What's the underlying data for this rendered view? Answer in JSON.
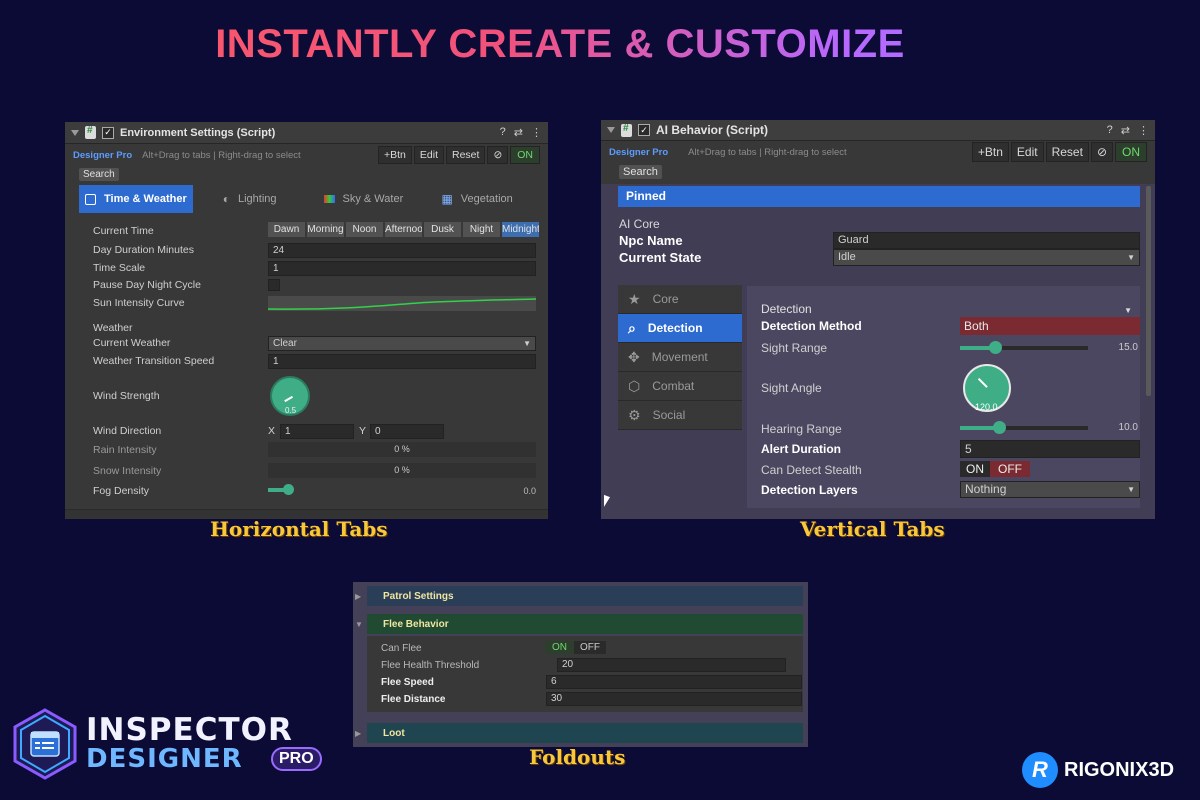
{
  "headline": "INSTANTLY CREATE & CUSTOMIZE",
  "common": {
    "brand": "Designer Pro",
    "hint": "Alt+Drag to tabs | Right-drag to select",
    "buttons": [
      "+Btn",
      "Edit",
      "Reset"
    ],
    "on_label": "ON",
    "search_label": "Search"
  },
  "horizontal_panel": {
    "title": "Environment Settings (Script)",
    "tabs": [
      {
        "label": "Time & Weather",
        "icon": "layout-icon"
      },
      {
        "label": "Lighting",
        "icon": "lightbulb-icon"
      },
      {
        "label": "Sky & Water",
        "icon": "palette-icon"
      },
      {
        "label": "Vegetation",
        "icon": "grid-icon"
      }
    ],
    "current_time_label": "Current Time",
    "time_options": [
      "Dawn",
      "Morning",
      "Noon",
      "Afternoon",
      "Dusk",
      "Night",
      "Midnight"
    ],
    "day_duration_label": "Day Duration Minutes",
    "day_duration_value": "24",
    "time_scale_label": "Time Scale",
    "time_scale_value": "1",
    "pause_label": "Pause Day Night Cycle",
    "sun_curve_label": "Sun Intensity Curve",
    "weather_header": "Weather",
    "current_weather_label": "Current Weather",
    "current_weather_value": "Clear",
    "weather_speed_label": "Weather Transition Speed",
    "weather_speed_value": "1",
    "wind_strength_label": "Wind Strength",
    "wind_strength_value": "0.5",
    "wind_direction_label": "Wind Direction",
    "wind_x_label": "X",
    "wind_x_value": "1",
    "wind_y_label": "Y",
    "wind_y_value": "0",
    "rain_label": "Rain Intensity",
    "rain_value": "0 %",
    "snow_label": "Snow Intensity",
    "snow_value": "0 %",
    "fog_label": "Fog Density",
    "fog_value": "0.0"
  },
  "vertical_panel": {
    "title": "AI Behavior (Script)",
    "pinned_label": "Pinned",
    "section_title": "AI Core",
    "npc_name_label": "Npc Name",
    "npc_name_value": "Guard",
    "current_state_label": "Current State",
    "current_state_value": "Idle",
    "tabs": [
      {
        "label": "Core",
        "icon": "star-icon"
      },
      {
        "label": "Detection",
        "icon": "magnifier-icon"
      },
      {
        "label": "Movement",
        "icon": "move-arrows-icon"
      },
      {
        "label": "Combat",
        "icon": "cube-icon"
      },
      {
        "label": "Social",
        "icon": "gear-icon"
      }
    ],
    "detection_header": "Detection",
    "detection_method_label": "Detection Method",
    "detection_method_value": "Both",
    "sight_range_label": "Sight Range",
    "sight_range_value": "15.0",
    "sight_angle_label": "Sight Angle",
    "sight_angle_value": "120.0",
    "hearing_range_label": "Hearing Range",
    "hearing_range_value": "10.0",
    "alert_duration_label": "Alert Duration",
    "alert_duration_value": "5",
    "stealth_label": "Can Detect Stealth",
    "stealth_on": "ON",
    "stealth_off": "OFF",
    "detection_layers_label": "Detection Layers",
    "detection_layers_value": "Nothing"
  },
  "foldout_panel": {
    "patrol_label": "Patrol Settings",
    "flee_label": "Flee Behavior",
    "can_flee_label": "Can Flee",
    "can_flee_on": "ON",
    "can_flee_off": "OFF",
    "flee_health_label": "Flee Health Threshold",
    "flee_health_value": "20",
    "flee_speed_label": "Flee Speed",
    "flee_speed_value": "6",
    "flee_distance_label": "Flee Distance",
    "flee_distance_value": "30",
    "loot_label": "Loot"
  },
  "captions": {
    "horizontal": "Horizontal Tabs",
    "vertical": "Vertical Tabs",
    "foldouts": "Foldouts"
  },
  "logo": {
    "line1": "INSPECTOR",
    "line2": "DESIGNER",
    "badge": "PRO"
  },
  "company": {
    "letter": "R",
    "name": "RIGONIX3D"
  },
  "colors": {
    "background": "#0b0b36",
    "accent_blue": "#2d6bd0",
    "slider_green": "#3fae87",
    "caption_gold": "#f7c83a"
  }
}
